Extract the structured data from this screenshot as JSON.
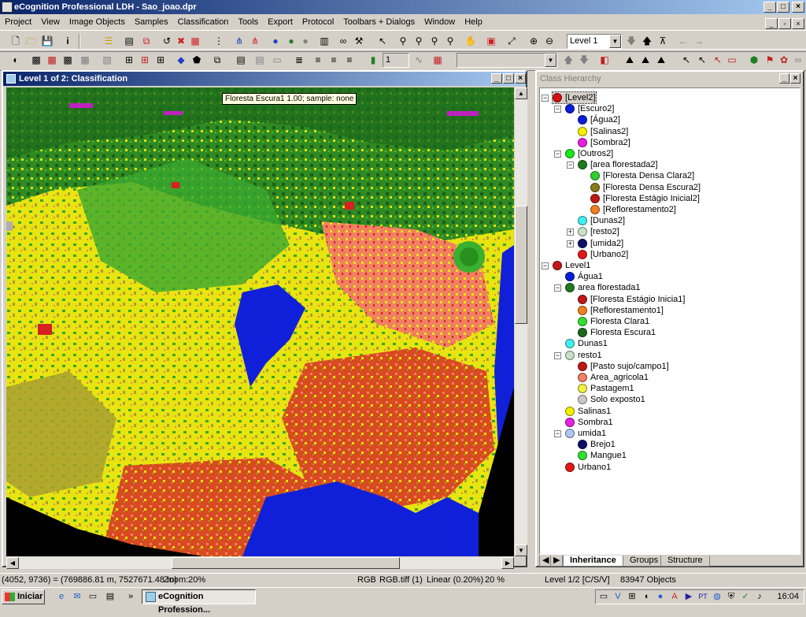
{
  "app": {
    "title": "eCognition Professional LDH - Sao_joao.dpr",
    "window_controls": {
      "minimize": "_",
      "maximize": "□",
      "close": "×"
    }
  },
  "menubar": {
    "items": [
      "Project",
      "View",
      "Image Objects",
      "Samples",
      "Classification",
      "Tools",
      "Export",
      "Protocol",
      "Toolbars + Dialogs",
      "Window",
      "Help"
    ]
  },
  "toolbar1": {
    "level_select": "Level 1"
  },
  "toolbar2": {
    "layer_value": "1",
    "feature_select": ""
  },
  "map_window": {
    "title": "Level 1 of 2: Classification",
    "tooltip": "Floresta Escura1 1.00;  sample: none"
  },
  "class_hierarchy": {
    "title": "Class Hierarchy",
    "nodes": [
      {
        "label": "[Level2]",
        "color": "#d01010",
        "depth": 0,
        "exp": "-"
      },
      {
        "label": "[Escuro2]",
        "color": "#0a1ed8",
        "depth": 1,
        "exp": "-"
      },
      {
        "label": "[Água2]",
        "color": "#0a1ed8",
        "depth": 2,
        "exp": ""
      },
      {
        "label": "[Salinas2]",
        "color": "#f4f000",
        "depth": 2,
        "exp": ""
      },
      {
        "label": "[Sombra2]",
        "color": "#e820e0",
        "depth": 2,
        "exp": ""
      },
      {
        "label": "[Outros2]",
        "color": "#18e818",
        "depth": 1,
        "exp": "-"
      },
      {
        "label": "[area florestada2]",
        "color": "#1e7a1e",
        "depth": 2,
        "exp": "-"
      },
      {
        "label": "[Floresta Densa Clara2]",
        "color": "#30d030",
        "depth": 3,
        "exp": ""
      },
      {
        "label": "[Floresta Densa Escura2]",
        "color": "#8a7a1a",
        "depth": 3,
        "exp": ""
      },
      {
        "label": "[Floresta Estágio Inicial2]",
        "color": "#c01818",
        "depth": 3,
        "exp": ""
      },
      {
        "label": "[Reflorestamento2]",
        "color": "#f08020",
        "depth": 3,
        "exp": ""
      },
      {
        "label": "[Dunas2]",
        "color": "#40f0f0",
        "depth": 2,
        "exp": ""
      },
      {
        "label": "[resto2]",
        "color": "#c8e0c8",
        "depth": 2,
        "exp": "+"
      },
      {
        "label": "[umida2]",
        "color": "#10106a",
        "depth": 2,
        "exp": "+"
      },
      {
        "label": "[Urbano2]",
        "color": "#e01818",
        "depth": 2,
        "exp": ""
      },
      {
        "label": "Level1",
        "color": "#c01818",
        "depth": 0,
        "exp": "-"
      },
      {
        "label": "Água1",
        "color": "#0a1ed8",
        "depth": 1,
        "exp": ""
      },
      {
        "label": "area florestada1",
        "color": "#1e7a1e",
        "depth": 1,
        "exp": "-"
      },
      {
        "label": "[Floresta Estágio Inicia1]",
        "color": "#c01818",
        "depth": 2,
        "exp": ""
      },
      {
        "label": "[Reflorestamento1]",
        "color": "#f08020",
        "depth": 2,
        "exp": ""
      },
      {
        "label": "Floresta Clara1",
        "color": "#30e030",
        "depth": 2,
        "exp": ""
      },
      {
        "label": "Floresta Escura1",
        "color": "#1a6a1a",
        "depth": 2,
        "exp": ""
      },
      {
        "label": "Dunas1",
        "color": "#40f0f0",
        "depth": 1,
        "exp": ""
      },
      {
        "label": "resto1",
        "color": "#c8e0c8",
        "depth": 1,
        "exp": "-"
      },
      {
        "label": "[Pasto sujo/campo1]",
        "color": "#c01818",
        "depth": 2,
        "exp": ""
      },
      {
        "label": "Area_agricola1",
        "color": "#f08060",
        "depth": 2,
        "exp": ""
      },
      {
        "label": "Pastagem1",
        "color": "#f4f040",
        "depth": 2,
        "exp": ""
      },
      {
        "label": "Solo exposto1",
        "color": "#c8c8c8",
        "depth": 2,
        "exp": ""
      },
      {
        "label": "Salinas1",
        "color": "#f4f000",
        "depth": 1,
        "exp": ""
      },
      {
        "label": "Sombra1",
        "color": "#e820e0",
        "depth": 1,
        "exp": ""
      },
      {
        "label": "umida1",
        "color": "#b0c8f0",
        "depth": 1,
        "exp": "-"
      },
      {
        "label": "Brejo1",
        "color": "#10106a",
        "depth": 2,
        "exp": ""
      },
      {
        "label": "Mangue1",
        "color": "#30e030",
        "depth": 2,
        "exp": ""
      },
      {
        "label": "Urbano1",
        "color": "#e01818",
        "depth": 1,
        "exp": ""
      }
    ],
    "tabs": [
      "Inheritance",
      "Groups",
      "Structure"
    ]
  },
  "statusbar": {
    "coords": "(4052, 9736) = (769886.81 m, 7527671.48 m)",
    "zoom": "Zoom:20%",
    "mode": "RGB",
    "image": "RGB.tiff (1)",
    "stretch": "Linear (0.20%)",
    "percent": "20 %",
    "level": "Level 1/2  [C/S/V]",
    "objects": "83947 Objects"
  },
  "taskbar": {
    "start": "Iniciar",
    "task": "eCognition Profession...",
    "clock": "16:04",
    "chevron": "»"
  }
}
